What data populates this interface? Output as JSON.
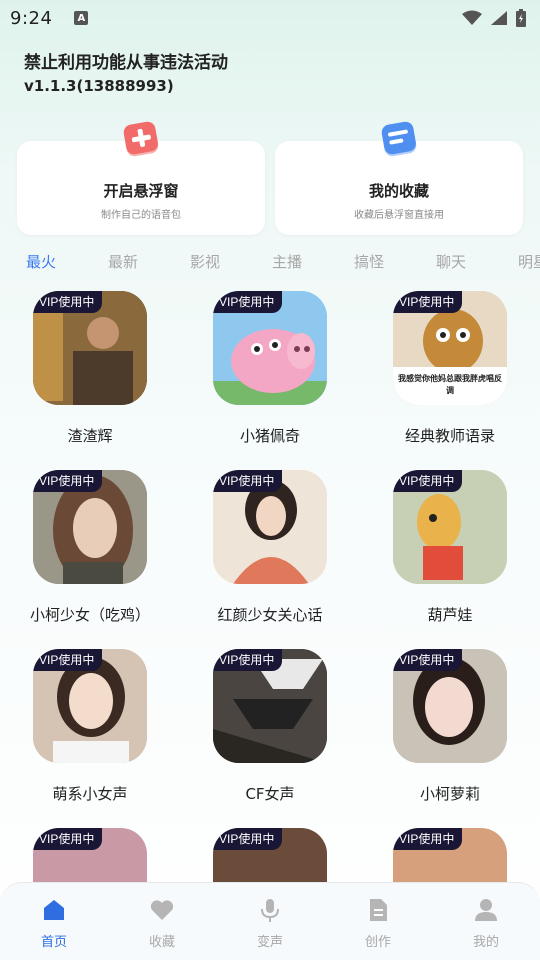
{
  "status": {
    "time": "9:24",
    "notif_icon": "a-icon"
  },
  "header": {
    "notice": "禁止利用功能从事违法活动",
    "version": "v1.1.3(13888993)"
  },
  "cards": [
    {
      "title": "开启悬浮窗",
      "subtitle": "制作自己的语音包",
      "icon": "plus-icon",
      "color": "#f26b6b"
    },
    {
      "title": "我的收藏",
      "subtitle": "收藏后悬浮窗直接用",
      "icon": "list-icon",
      "color": "#4f8ff0"
    }
  ],
  "tabs": [
    {
      "label": "最火",
      "active": true
    },
    {
      "label": "最新",
      "active": false
    },
    {
      "label": "影视",
      "active": false
    },
    {
      "label": "主播",
      "active": false
    },
    {
      "label": "搞怪",
      "active": false
    },
    {
      "label": "聊天",
      "active": false
    },
    {
      "label": "明星",
      "active": false
    }
  ],
  "badge": "VIP使用中",
  "items": [
    {
      "name": "渣渣辉",
      "bg": "#6b4a2a"
    },
    {
      "name": "小猪佩奇",
      "bg": "#8ec8ef"
    },
    {
      "name": "经典教师语录",
      "bg": "#d7c3a8",
      "caption": "我感觉你他妈总跟我胖虎唱反调"
    },
    {
      "name": "小柯少女（吃鸡）",
      "bg": "#8a8f82"
    },
    {
      "name": "红颜少女关心话",
      "bg": "#e9ddd1"
    },
    {
      "name": "葫芦娃",
      "bg": "#b9c7a6"
    },
    {
      "name": "萌系小女声",
      "bg": "#c9b3a4"
    },
    {
      "name": "CF女声",
      "bg": "#3e3a36"
    },
    {
      "name": "小柯萝莉",
      "bg": "#cfb9b4"
    },
    {
      "name": "",
      "bg": "#c99aa6"
    },
    {
      "name": "",
      "bg": "#6b4c3a"
    },
    {
      "name": "",
      "bg": "#d6a07c"
    }
  ],
  "nav": [
    {
      "label": "首页",
      "icon": "home-icon",
      "active": true
    },
    {
      "label": "收藏",
      "icon": "heart-icon",
      "active": false
    },
    {
      "label": "变声",
      "icon": "mic-icon",
      "active": false
    },
    {
      "label": "创作",
      "icon": "document-icon",
      "active": false
    },
    {
      "label": "我的",
      "icon": "person-icon",
      "active": false
    }
  ],
  "colors": {
    "accent": "#3b7cf0",
    "badge_bg": "#1a1636"
  }
}
